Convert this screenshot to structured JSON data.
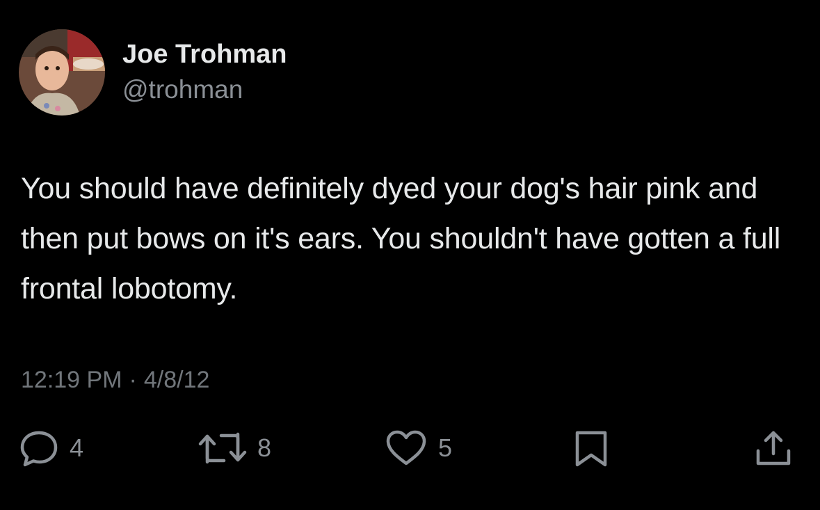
{
  "author": {
    "name": "Joe Trohman",
    "handle": "@trohman",
    "avatar_icon": "profile-photo-icon"
  },
  "tweet": {
    "text": "You should have definitely dyed your dog's hair pink and then put bows on it's ears. You shouldn't have gotten a full frontal lobotomy.",
    "time": "12:19 PM",
    "separator": "·",
    "date": "4/8/12"
  },
  "actions": {
    "replies": "4",
    "retweets": "8",
    "likes": "5"
  },
  "colors": {
    "background": "#000000",
    "primary_text": "#e7e9ea",
    "secondary_text": "#71767b",
    "icon": "#8b9096"
  }
}
